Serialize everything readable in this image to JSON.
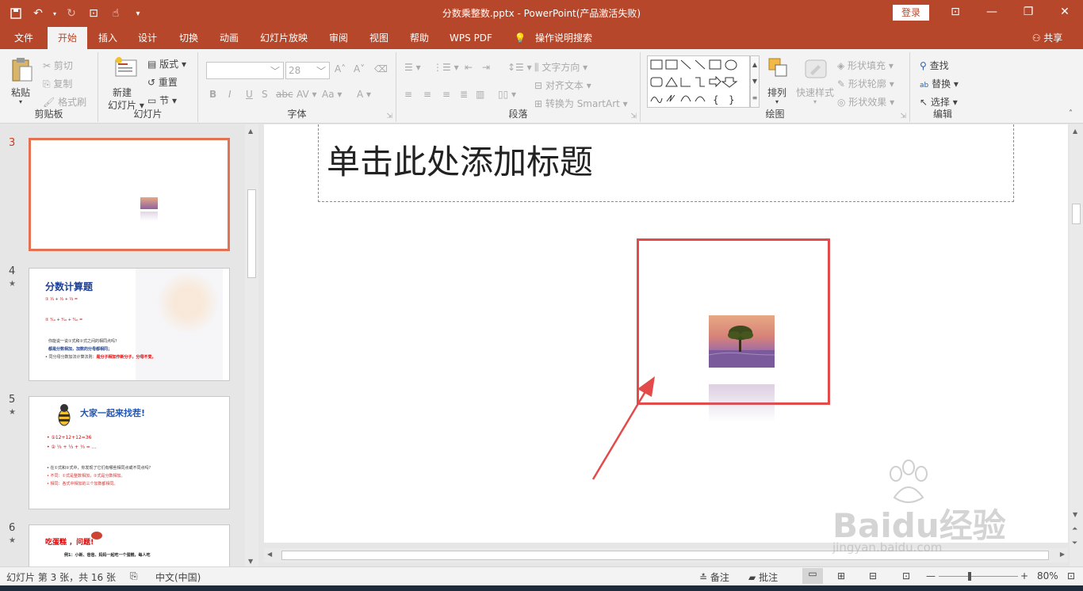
{
  "window": {
    "title": "分数乘整数.pptx  -  PowerPoint(产品激活失败)",
    "login_label": "登录",
    "share_label": "共享"
  },
  "tabs": [
    "文件",
    "开始",
    "插入",
    "设计",
    "切换",
    "动画",
    "幻灯片放映",
    "审阅",
    "视图",
    "帮助",
    "WPS PDF",
    "操作说明搜索"
  ],
  "ribbon": {
    "clipboard": {
      "paste": "粘贴",
      "cut": "剪切",
      "copy": "复制",
      "format_painter": "格式刷",
      "label": "剪贴板"
    },
    "slides": {
      "new_slide": "新建",
      "new_slide2": "幻灯片",
      "layout": "版式",
      "reset": "重置",
      "section": "节",
      "label": "幻灯片"
    },
    "font": {
      "size_value": "28",
      "label": "字体",
      "bold": "B",
      "italic": "I",
      "underline": "U",
      "strike": "abc",
      "spacing": "AV",
      "case": "Aa",
      "color": "A"
    },
    "paragraph": {
      "text_direction": "文字方向",
      "align_text": "对齐文本",
      "smartart": "转换为 SmartArt",
      "label": "段落"
    },
    "drawing": {
      "arrange": "排列",
      "quick_styles": "快速样式",
      "fill": "形状填充",
      "outline": "形状轮廓",
      "effects": "形状效果",
      "label": "绘图"
    },
    "editing": {
      "find": "查找",
      "replace": "替换",
      "select": "选择",
      "label": "编辑"
    }
  },
  "slides_panel": [
    {
      "num": "3",
      "selected": true,
      "star": ""
    },
    {
      "num": "4",
      "selected": false,
      "star": "★",
      "title": "分数计算题"
    },
    {
      "num": "5",
      "selected": false,
      "star": "★",
      "title": "大家一起来找茬!"
    },
    {
      "num": "6",
      "selected": false,
      "star": "★",
      "title": "吃蛋糕    ，问题!"
    }
  ],
  "slide4_text": {
    "q": "你能说一说①式和②式之间的相同点吗？",
    "a": "都是分数相加，加数的分母都相同；",
    "b": "• 同分母分数加法计算法则：",
    "c": "是分子相加作新分子，分母不变。"
  },
  "slide5_text": {
    "l1": "• ①12+12+12=36",
    "l3": "• 在①式和②式中，你发现了它们有哪些相同点或不同点吗？",
    "l4": "• 不同：①式是整数相加，②式是分数相加。",
    "l5": "• 相同：各式中相加的三个加数都相同。"
  },
  "slide6_text": {
    "l1": "例1：小新、爸爸、妈妈一起吃一个蛋糕，每人吃"
  },
  "editor": {
    "title_placeholder": "单击此处添加标题"
  },
  "status": {
    "slide_info": "幻灯片 第 3 张，共 16 张",
    "language": "中文(中国)",
    "notes": "备注",
    "comments": "批注",
    "zoom": "80%",
    "zoom_level": 0.8
  },
  "watermark": {
    "text": "Baidu经验",
    "sub": "jingyan.baidu.com"
  },
  "colors": {
    "accent": "#b7472a",
    "selection": "#e27252",
    "highlight_box": "#e34b4b"
  }
}
